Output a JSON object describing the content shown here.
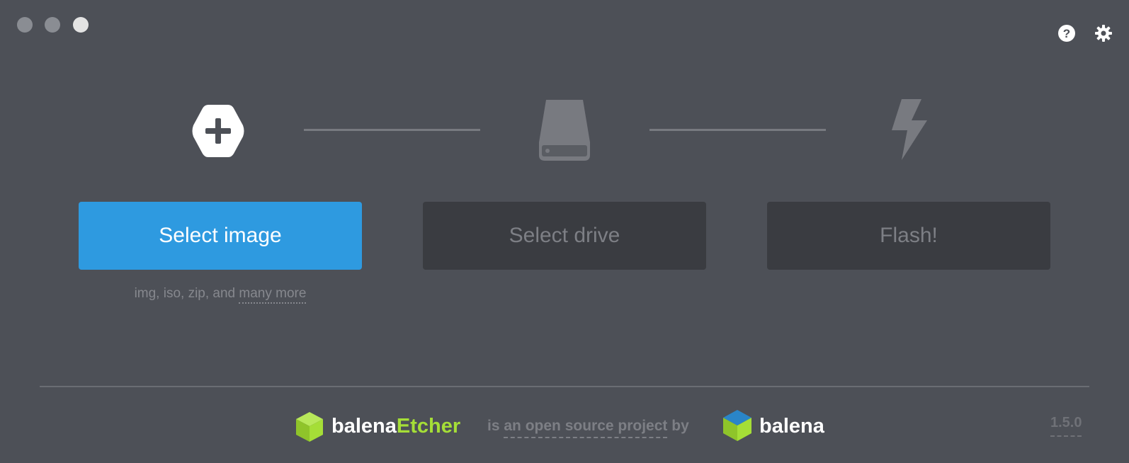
{
  "window": {
    "controls": [
      {
        "name": "close",
        "icon": "circle-button"
      },
      {
        "name": "minimize",
        "icon": "circle-button"
      },
      {
        "name": "maximize",
        "icon": "circle-button"
      }
    ]
  },
  "header": {
    "help_icon": "help-circle-icon",
    "settings_icon": "gear-icon"
  },
  "steps": {
    "image": {
      "icon": "hexagon-plus-icon",
      "button_label": "Select image"
    },
    "drive": {
      "icon": "hard-drive-icon",
      "button_label": "Select drive"
    },
    "flash": {
      "icon": "lightning-bolt-icon",
      "button_label": "Flash!"
    }
  },
  "hint": {
    "prefix": "img, iso, zip, and ",
    "link": "many more"
  },
  "footer": {
    "brand_name": "balena",
    "brand_accent": "Etcher",
    "tagline_prefix": "is ",
    "tagline_link": "an open source project",
    "tagline_suffix": " by",
    "company": "balena",
    "version": "1.5.0"
  },
  "colors": {
    "background": "#4d5057",
    "primary_button": "#2e9ae0",
    "disabled_button": "#3a3c41",
    "accent_green": "#a5de37",
    "balena_blue": "#2a85c8"
  }
}
